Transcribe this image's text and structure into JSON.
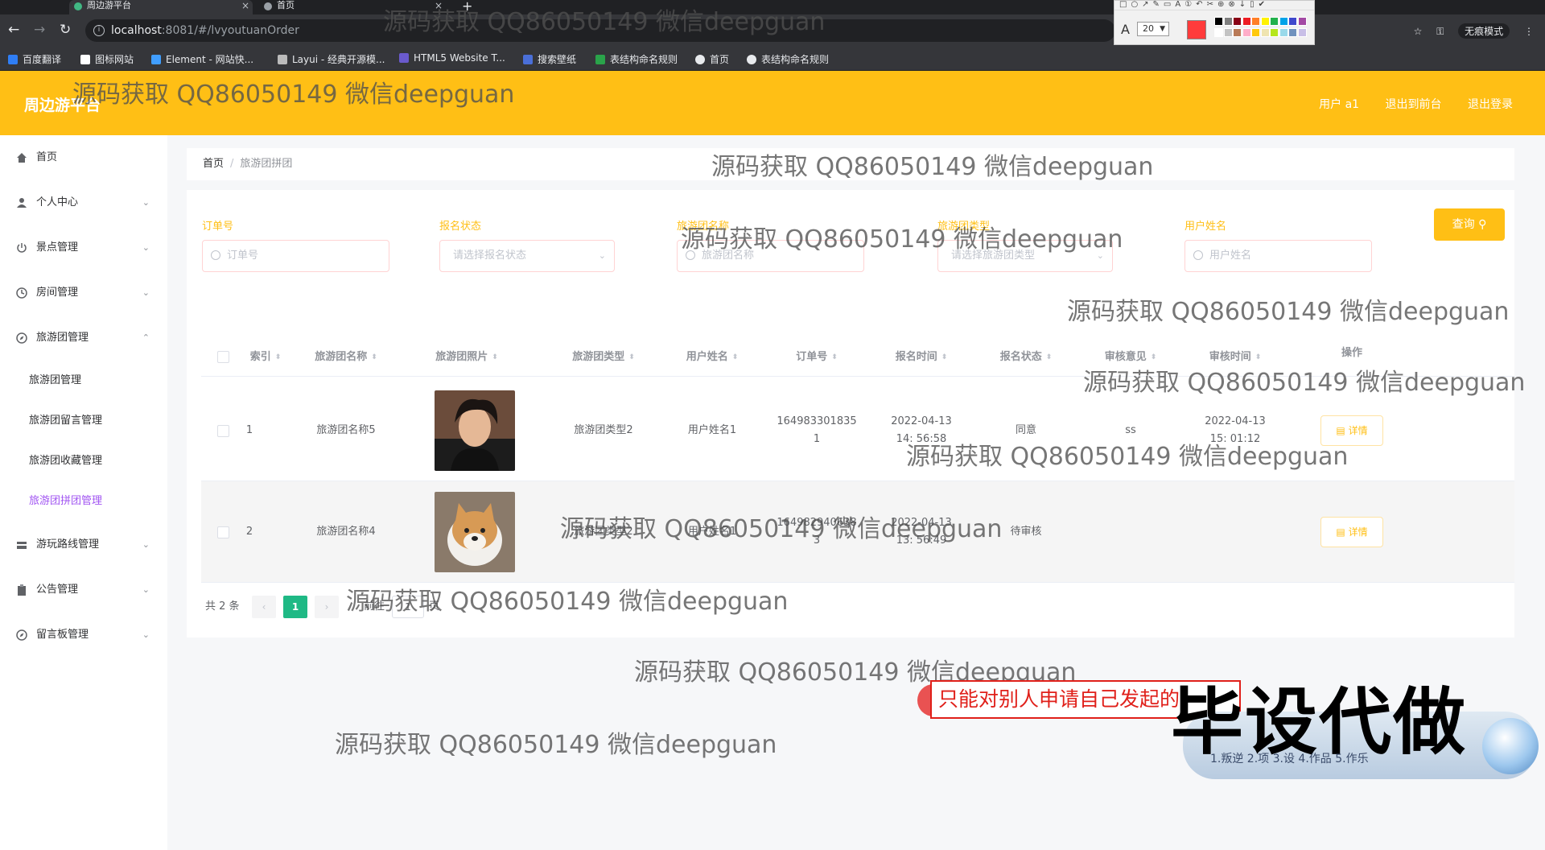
{
  "browser": {
    "tabs": [
      {
        "title": "周边游平台"
      },
      {
        "title": "首页"
      }
    ],
    "url_host": "localhost",
    "url_path": ":8081/#/lvyoutuanOrder",
    "incognito_label": "无痕模式",
    "bookmarks": [
      {
        "label": "百度翻译",
        "color": "#2f7ef5"
      },
      {
        "label": "图标网站",
        "color": "#ffffff"
      },
      {
        "label": "Element - 网站快...",
        "color": "#409eff"
      },
      {
        "label": "Layui - 经典开源模...",
        "color": "#bbbbbb"
      },
      {
        "label": "HTML5 Website T...",
        "color": "#6a5acd"
      },
      {
        "label": "搜索壁纸",
        "color": "#4a6fd8"
      },
      {
        "label": "表结构命名规则",
        "color": "#2aa34a"
      },
      {
        "label": "首页",
        "color": "#e8eaed"
      },
      {
        "label": "表结构命名规则",
        "color": "#e8eaed"
      }
    ]
  },
  "drawing_toolbar": {
    "font_size": "20",
    "current_color": "#ff3b3b",
    "palette": [
      "#000000",
      "#7f7f7f",
      "#880015",
      "#ed1c24",
      "#ff7f27",
      "#fff200",
      "#22b14c",
      "#00a2e8",
      "#3f48cc",
      "#a349a4",
      "#ffffff",
      "#c3c3c3",
      "#b97a57",
      "#ffaec9",
      "#ffc90e",
      "#efe4b0",
      "#b5e61d",
      "#99d9ea",
      "#7092be",
      "#c8bfe7"
    ]
  },
  "header": {
    "logo": "周边游平台",
    "user_label": "用户 a1",
    "back_label": "退出到前台",
    "logout_label": "退出登录"
  },
  "sidebar": {
    "items": [
      {
        "label": "首页",
        "icon": "home-icon",
        "arrow": ""
      },
      {
        "label": "个人中心",
        "icon": "user-icon",
        "arrow": "⌄"
      },
      {
        "label": "景点管理",
        "icon": "power-icon",
        "arrow": "⌄"
      },
      {
        "label": "房间管理",
        "icon": "clock-icon",
        "arrow": "⌄"
      },
      {
        "label": "旅游团管理",
        "icon": "compass-icon",
        "arrow": "⌃"
      }
    ],
    "sub_items": [
      {
        "label": "旅游团管理"
      },
      {
        "label": "旅游团留言管理"
      },
      {
        "label": "旅游团收藏管理"
      },
      {
        "label": "旅游团拼团管理"
      }
    ],
    "items_after": [
      {
        "label": "游玩路线管理",
        "icon": "layers-icon",
        "arrow": "⌄"
      },
      {
        "label": "公告管理",
        "icon": "clipboard-icon",
        "arrow": "⌄"
      },
      {
        "label": "留言板管理",
        "icon": "compass-icon",
        "arrow": "⌄"
      }
    ]
  },
  "breadcrumb": {
    "home": "首页",
    "current": "旅游团拼团"
  },
  "filters": [
    {
      "label": "订单号",
      "placeholder": "订单号"
    },
    {
      "label": "报名状态",
      "placeholder": "请选择报名状态"
    },
    {
      "label": "旅游团名称",
      "placeholder": "旅游团名称"
    },
    {
      "label": "旅游团类型",
      "placeholder": "请选择旅游团类型"
    },
    {
      "label": "用户姓名",
      "placeholder": "用户姓名"
    }
  ],
  "query_button": "查询",
  "table": {
    "headers": [
      "索引",
      "旅游团名称",
      "旅游团照片",
      "旅游团类型",
      "用户姓名",
      "订单号",
      "报名时间",
      "报名状态",
      "审核意见",
      "审核时间",
      "操作"
    ],
    "rows": [
      {
        "index": "1",
        "name": "旅游团名称5",
        "type": "旅游团类型2",
        "user": "用户姓名1",
        "order": "164983301835 1",
        "signup_time": "2022-04-13 14: 56:58",
        "status": "同意",
        "opinion": "ss",
        "review_time": "2022-04-13 15: 01:12",
        "action": "详情"
      },
      {
        "index": "2",
        "name": "旅游团名称4",
        "type": "旅游团类型2",
        "user": "用户姓名1",
        "order": "164982940638 3",
        "signup_time": "2022-04-13 13: 56:49",
        "status": "待审核",
        "opinion": "",
        "review_time": "",
        "action": "详情"
      }
    ]
  },
  "pagination": {
    "total": "共 2 条",
    "current": "1",
    "goto_prefix": "前往",
    "goto_value": "1",
    "goto_suffix": "页"
  },
  "watermark_text": "源码获取 QQ86050149 微信deepguan",
  "caption": "只能对别人申请自己发起的",
  "promo": {
    "title": "毕设代做",
    "subtitle": "1.叛逆 2.项 3.设 4.作品 5.作乐"
  }
}
